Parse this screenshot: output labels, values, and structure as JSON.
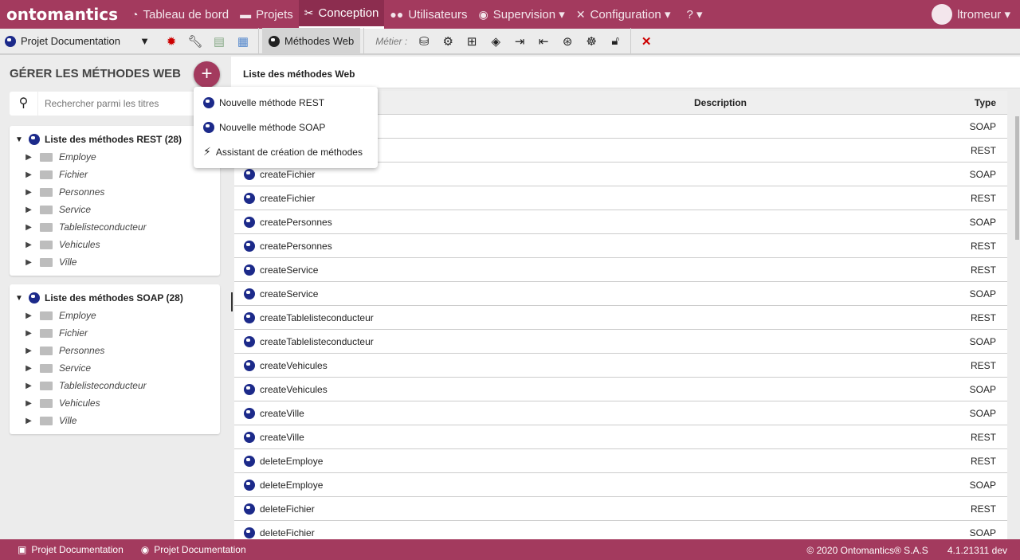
{
  "brand": {
    "logo": "ontomantics",
    "accent": "#a33a5e"
  },
  "nav": [
    {
      "label": "Tableau de bord",
      "icon": "dashboard-icon"
    },
    {
      "label": "Projets",
      "icon": "briefcase-icon"
    },
    {
      "label": "Conception",
      "icon": "tools-icon",
      "active": true
    },
    {
      "label": "Utilisateurs",
      "icon": "users-icon"
    },
    {
      "label": "Supervision ▾",
      "icon": "eye-icon"
    },
    {
      "label": "Configuration ▾",
      "icon": "wrench-icon"
    },
    {
      "label": "? ▾",
      "icon": "help-icon"
    }
  ],
  "user": {
    "name": "ltromeur ▾"
  },
  "toolbar": {
    "project": "Projet Documentation",
    "methodes_web": "Méthodes Web",
    "metier": "Métier :",
    "close": "✕"
  },
  "left": {
    "title": "GÉRER LES MÉTHODES WEB",
    "add": "+",
    "search_placeholder": "Rechercher parmi les titres",
    "rest": {
      "title": "Liste des méthodes REST (28)",
      "items": [
        "Employe",
        "Fichier",
        "Personnes",
        "Service",
        "Tablelisteconducteur",
        "Vehicules",
        "Ville"
      ]
    },
    "soap": {
      "title": "Liste des méthodes SOAP (28)",
      "items": [
        "Employe",
        "Fichier",
        "Personnes",
        "Service",
        "Tablelisteconducteur",
        "Vehicules",
        "Ville"
      ]
    }
  },
  "menu": [
    "Nouvelle méthode REST",
    "Nouvelle méthode SOAP",
    "Assistant de création de méthodes"
  ],
  "main": {
    "breadcrumb": "Liste des méthodes Web",
    "columns": [
      "",
      "Description",
      "Type"
    ],
    "rows": [
      [
        "",
        "",
        "SOAP"
      ],
      [
        "",
        "",
        "REST"
      ],
      [
        "createFichier",
        "",
        "SOAP"
      ],
      [
        "createFichier",
        "",
        "REST"
      ],
      [
        "createPersonnes",
        "",
        "SOAP"
      ],
      [
        "createPersonnes",
        "",
        "REST"
      ],
      [
        "createService",
        "",
        "REST"
      ],
      [
        "createService",
        "",
        "SOAP"
      ],
      [
        "createTablelisteconducteur",
        "",
        "REST"
      ],
      [
        "createTablelisteconducteur",
        "",
        "SOAP"
      ],
      [
        "createVehicules",
        "",
        "REST"
      ],
      [
        "createVehicules",
        "",
        "SOAP"
      ],
      [
        "createVille",
        "",
        "SOAP"
      ],
      [
        "createVille",
        "",
        "REST"
      ],
      [
        "deleteEmploye",
        "",
        "REST"
      ],
      [
        "deleteEmploye",
        "",
        "SOAP"
      ],
      [
        "deleteFichier",
        "",
        "REST"
      ],
      [
        "deleteFichier",
        "",
        "SOAP"
      ]
    ]
  },
  "footer": {
    "crumb1": "Projet Documentation",
    "crumb2": "Projet Documentation",
    "copyright": "© 2020 Ontomantics® S.A.S",
    "version": "4.1.21311 dev"
  }
}
